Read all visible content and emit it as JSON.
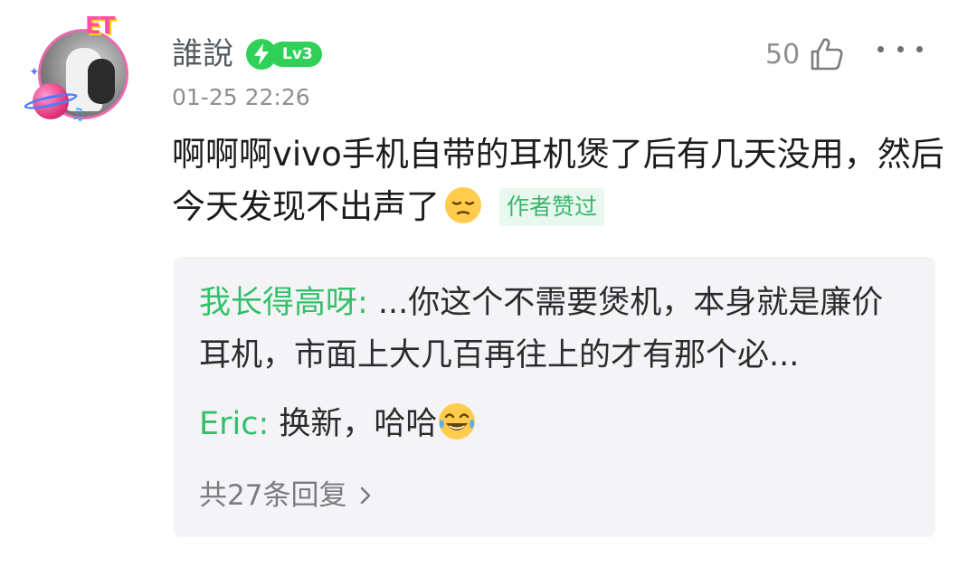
{
  "comment": {
    "username": "誰說",
    "level": "Lv3",
    "timestamp": "01-25 22:26",
    "like_count": "50",
    "text": "啊啊啊vivo手机自带的耳机煲了后有几天没用，然后今天发现不出声了",
    "author_liked_label": "作者赞过",
    "avatar_badge_text": "ET"
  },
  "replies": [
    {
      "author": "我长得高呀:",
      "text": " ...你这个不需要煲机，本身就是廉价耳机，市面上大几百再往上的才有那个必..."
    },
    {
      "author": "Eric:",
      "text": " 换新，哈哈"
    }
  ],
  "more_replies_label": "共27条回复",
  "colors": {
    "accent_green": "#34c06a",
    "level_green": "#30d158",
    "author_liked_bg": "#e8f8ee",
    "reply_box_bg": "#f4f4f6"
  },
  "icons": {
    "level": "lightning-icon",
    "like": "thumbs-up-icon",
    "more": "more-dots-icon",
    "chevron": "chevron-right-icon",
    "emoji_1": "pensive-face-emoji",
    "emoji_2": "laughing-tears-emoji"
  }
}
